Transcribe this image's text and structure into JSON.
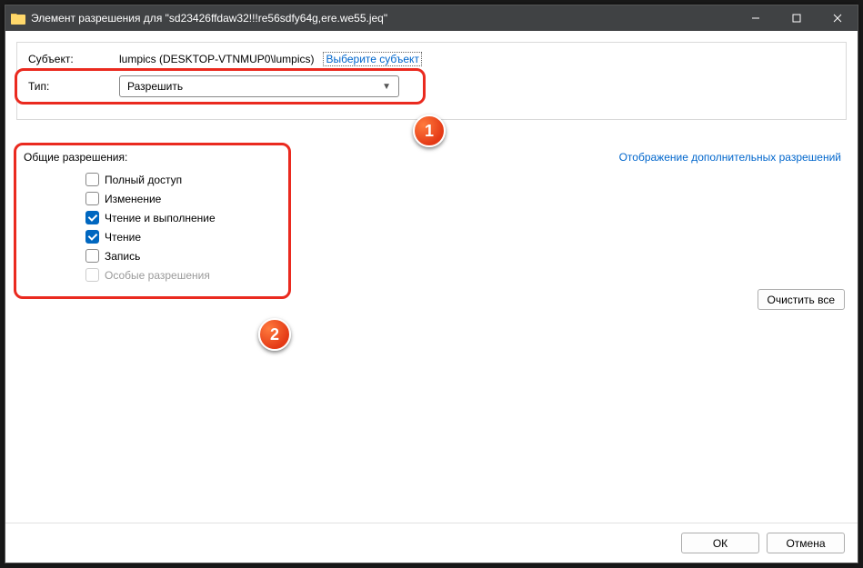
{
  "window": {
    "title": "Элемент разрешения для \"sd23426ffdaw32!!!re56sdfy64g,ere.we55.jeq\""
  },
  "header": {
    "subject_label": "Субъект:",
    "subject_value": "lumpics (DESKTOP-VTNMUP0\\lumpics)",
    "select_subject_link": "Выберите субъект",
    "type_label": "Тип:",
    "type_value": "Разрешить"
  },
  "perms": {
    "title": "Общие разрешения:",
    "advanced_link": "Отображение дополнительных разрешений",
    "items": [
      {
        "label": "Полный доступ",
        "checked": false,
        "disabled": false
      },
      {
        "label": "Изменение",
        "checked": false,
        "disabled": false
      },
      {
        "label": "Чтение и выполнение",
        "checked": true,
        "disabled": false
      },
      {
        "label": "Чтение",
        "checked": true,
        "disabled": false
      },
      {
        "label": "Запись",
        "checked": false,
        "disabled": false
      },
      {
        "label": "Особые разрешения",
        "checked": false,
        "disabled": true
      }
    ],
    "clear_all": "Очистить все"
  },
  "footer": {
    "ok": "ОК",
    "cancel": "Отмена"
  },
  "callouts": {
    "one": "1",
    "two": "2"
  }
}
